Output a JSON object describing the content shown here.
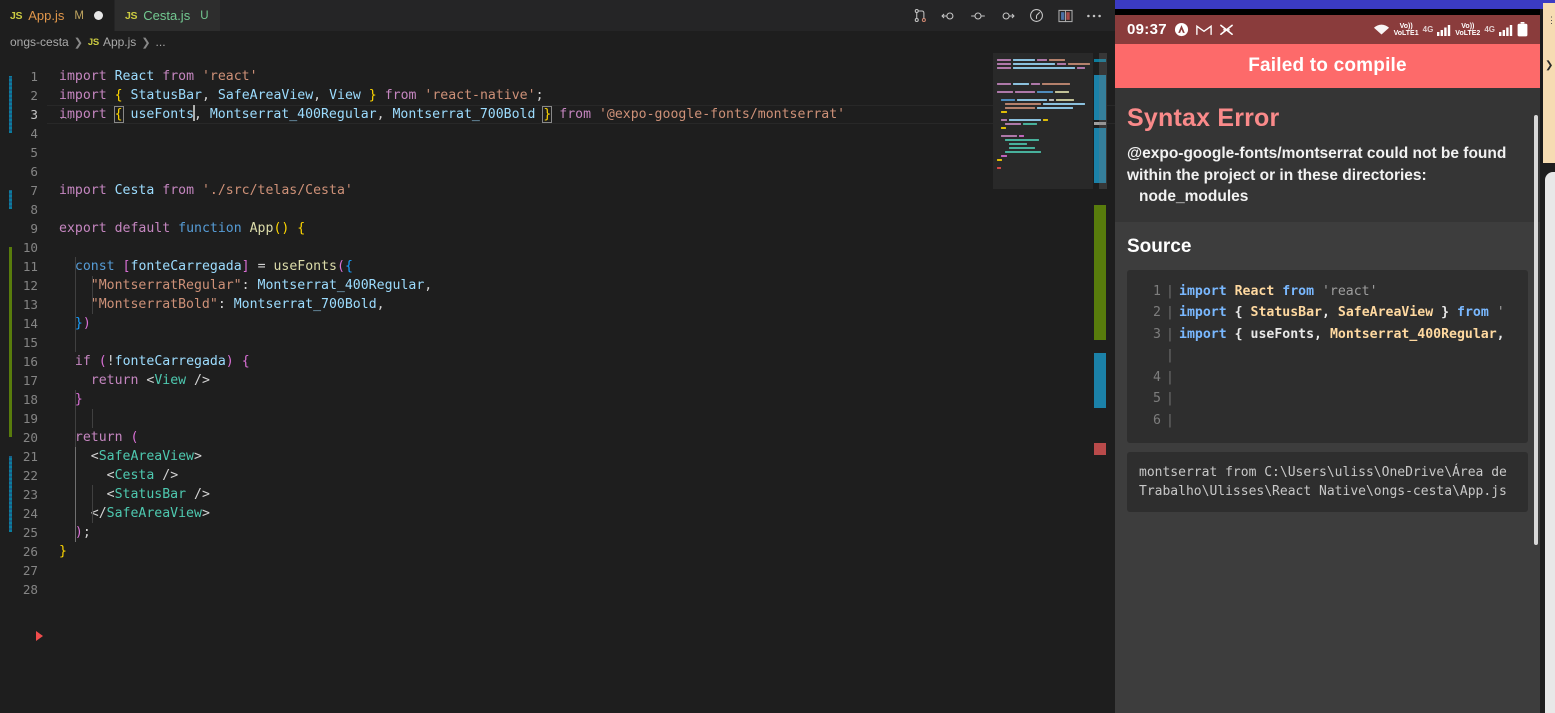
{
  "editor": {
    "tabs": [
      {
        "icon": "js-icon",
        "name": "App.js",
        "git_status": "M",
        "dirty": true,
        "active": true
      },
      {
        "icon": "js-icon",
        "name": "Cesta.js",
        "git_status": "U",
        "dirty": false,
        "active": false
      }
    ],
    "tab_actions": [
      {
        "name": "run-and-debug-icon",
        "label": "Split Debug"
      },
      {
        "name": "debug-step-back-icon",
        "label": "Step Back"
      },
      {
        "name": "debug-step-over-icon",
        "label": "Step Over"
      },
      {
        "name": "debug-step-into-icon",
        "label": "Step Into"
      },
      {
        "name": "debug-start-icon",
        "label": "Start Debugging"
      },
      {
        "name": "split-editor-icon",
        "label": "Split Editor Right"
      },
      {
        "name": "more-actions-icon",
        "label": "More Actions..."
      }
    ],
    "breadcrumbs": [
      {
        "label": "ongs-cesta",
        "icon": ""
      },
      {
        "label": "App.js",
        "icon": "js-icon"
      },
      {
        "label": "...",
        "icon": ""
      }
    ],
    "folded_marker": "...",
    "lines": [
      {
        "n": "1",
        "text": "import React from 'react'"
      },
      {
        "n": "2",
        "text": "import { StatusBar, SafeAreaView, View } from 'react-native';"
      },
      {
        "n": "3",
        "text": "import { useFonts, Montserrat_400Regular, Montserrat_700Bold } from '@expo-google-fonts/montserrat'"
      },
      {
        "n": "4",
        "text": ""
      },
      {
        "n": "5",
        "text": ""
      },
      {
        "n": "6",
        "text": ""
      },
      {
        "n": "7",
        "text": "import Cesta from './src/telas/Cesta'"
      },
      {
        "n": "8",
        "text": ""
      },
      {
        "n": "9",
        "text": "export default function App() {"
      },
      {
        "n": "10",
        "text": ""
      },
      {
        "n": "11",
        "text": "  const [fonteCarregada] = useFonts({"
      },
      {
        "n": "12",
        "text": "    \"MontserratRegular\": Montserrat_400Regular,"
      },
      {
        "n": "13",
        "text": "    \"MontserratBold\": Montserrat_700Bold,"
      },
      {
        "n": "14",
        "text": "  })"
      },
      {
        "n": "15",
        "text": ""
      },
      {
        "n": "16",
        "text": "  if (!fonteCarregada) {"
      },
      {
        "n": "17",
        "text": "    return <View />"
      },
      {
        "n": "18",
        "text": "  }"
      },
      {
        "n": "19",
        "text": ""
      },
      {
        "n": "20",
        "text": "  return ("
      },
      {
        "n": "21",
        "text": "    <SafeAreaView>"
      },
      {
        "n": "22",
        "text": "      <Cesta />"
      },
      {
        "n": "23",
        "text": "      <StatusBar />"
      },
      {
        "n": "24",
        "text": "    </SafeAreaView>"
      },
      {
        "n": "25",
        "text": "  );"
      },
      {
        "n": "26",
        "text": "}"
      },
      {
        "n": "27",
        "text": ""
      },
      {
        "n": "28",
        "text": ""
      }
    ],
    "cursor_line": 3,
    "colors": {
      "background": "#1e1e1e",
      "tabbar": "#252526",
      "keyword": "#c586c0",
      "string": "#ce9178",
      "variable": "#9cdcfe",
      "function": "#dcdcaa",
      "tag": "#4ec9b0",
      "error": "#f14c4c"
    }
  },
  "phone": {
    "statusbar": {
      "time": "09:37",
      "left_icons": [
        "shield-icon",
        "gmail-icon",
        "call-muted-icon"
      ],
      "right_icons": [
        "wifi-icon",
        "signal-sim1-icon",
        "signal-sim2-icon",
        "signal-icon",
        "battery-icon"
      ],
      "sim1_label": "VoLTE1",
      "sim2_label": "VoLTE2",
      "network1": "4G",
      "network2": "4G",
      "bg_color": "#8a3c3c"
    },
    "banner": {
      "title": "Failed to compile",
      "bg_color": "#fd6a6a"
    },
    "error": {
      "heading": "Syntax Error",
      "heading_color": "#fa8a8a",
      "message_line1": "@expo-google-fonts/montserrat could not be found",
      "message_line2": "within the project or in these directories:",
      "message_line3": "node_modules"
    },
    "source": {
      "heading": "Source",
      "lines": [
        {
          "n": "1",
          "code": "import React from 'react'"
        },
        {
          "n": "2",
          "code": "import { StatusBar, SafeAreaView } from '"
        },
        {
          "n": "3",
          "code": "import { useFonts, Montserrat_400Regular,"
        },
        {
          "n": "",
          "code": ""
        },
        {
          "n": "4",
          "code": ""
        },
        {
          "n": "5",
          "code": ""
        },
        {
          "n": "6",
          "code": ""
        }
      ],
      "path": "montserrat from C:\\Users\\uliss\\OneDrive\\Área de Trabalho\\Ulisses\\React Native\\ongs-cesta\\App.js"
    }
  }
}
